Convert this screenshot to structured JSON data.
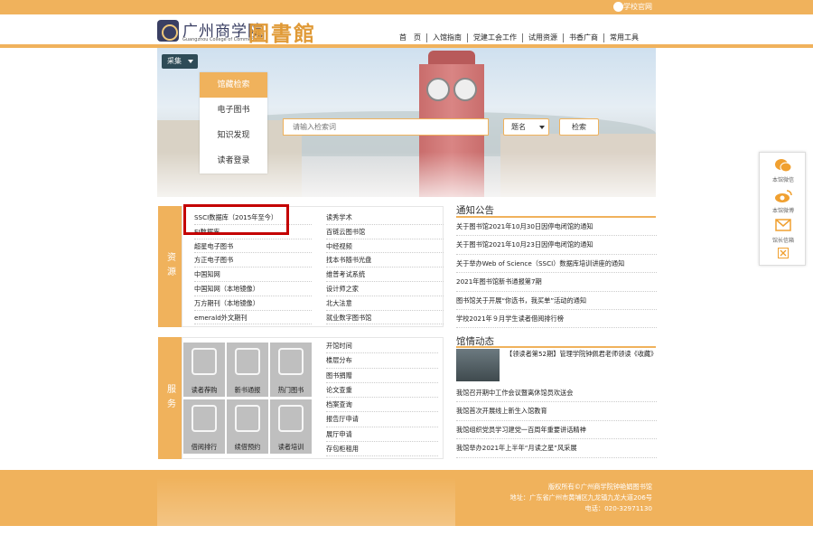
{
  "topbar": {
    "official_label": "学校官网"
  },
  "header": {
    "school_name": "广州商学院",
    "school_name_en": "Guangzhou College of Commerce",
    "library_name": "圖書館"
  },
  "nav": [
    "首　页",
    "入馆指南",
    "党建工会工作",
    "试用资源",
    "书香广商",
    "常用工具"
  ],
  "banner": {
    "collect_label": "采集",
    "search_tabs": [
      "馆藏检索",
      "电子图书",
      "知识发现",
      "读者登录"
    ],
    "search_placeholder": "请输入检索词",
    "search_field": "题名",
    "search_button": "检索"
  },
  "resources": {
    "label": "资源",
    "col1": [
      "SSCI数据库（2015年至今）",
      "EI数据库",
      "超星电子图书",
      "方正电子图书",
      "中国知网",
      "中国知网（本地镜像）",
      "万方期刊（本地镜像）",
      "emerald外文期刊"
    ],
    "col2": [
      "读秀学术",
      "百链云图书馆",
      "中经视频",
      "找本书随书光盘",
      "维普考试系统",
      "设计师之家",
      "北大法意",
      "就业数字图书馆"
    ]
  },
  "services": {
    "label": "服务",
    "tiles": [
      "读者荐购",
      "新书通报",
      "热门图书",
      "借阅排行",
      "续借预约",
      "读者培训"
    ],
    "links": [
      "开馆时间",
      "楼层分布",
      "图书捐赠",
      "论文查重",
      "档案查询",
      "报告厅申请",
      "展厅申请",
      "存包柜租用"
    ]
  },
  "notices": {
    "title": "通知公告",
    "items": [
      "关于图书馆2021年10月30日因停电闭馆的通知",
      "关于图书馆2021年10月23日因停电闭馆的通知",
      "关于举办Web of Science（SSCI）数据库培训讲座的通知",
      "2021年图书馆新书通报第7期",
      "图书馆关于开展“你选书，我买单”活动的通知",
      "学校2021年９月学生读者借阅排行榜"
    ]
  },
  "news": {
    "title": "馆情动态",
    "featured": "【领读者第52期】管理学院钟佩君老师领读《收藏》",
    "items": [
      "我馆召开期中工作会议暨离休馆员欢送会",
      "我馆首次开展线上新生入馆教育",
      "我馆组织党员学习建党一百周年重要讲话精神",
      "我馆举办2021年上半年“月读之星”风采展"
    ]
  },
  "float_bar": {
    "wechat": "本馆微信",
    "weibo": "本馆微博",
    "mail": "馆长信箱"
  },
  "footer": {
    "copyright": "版权所有©广州商学院钟艳娟图书馆",
    "address": "地址：广东省广州市黄埔区九龙镇九龙大道206号",
    "phone": "电话：020-32971130"
  },
  "colors": {
    "accent": "#f0b25c",
    "dark_button": "#2e4b57",
    "highlight_box": "#c40000"
  }
}
